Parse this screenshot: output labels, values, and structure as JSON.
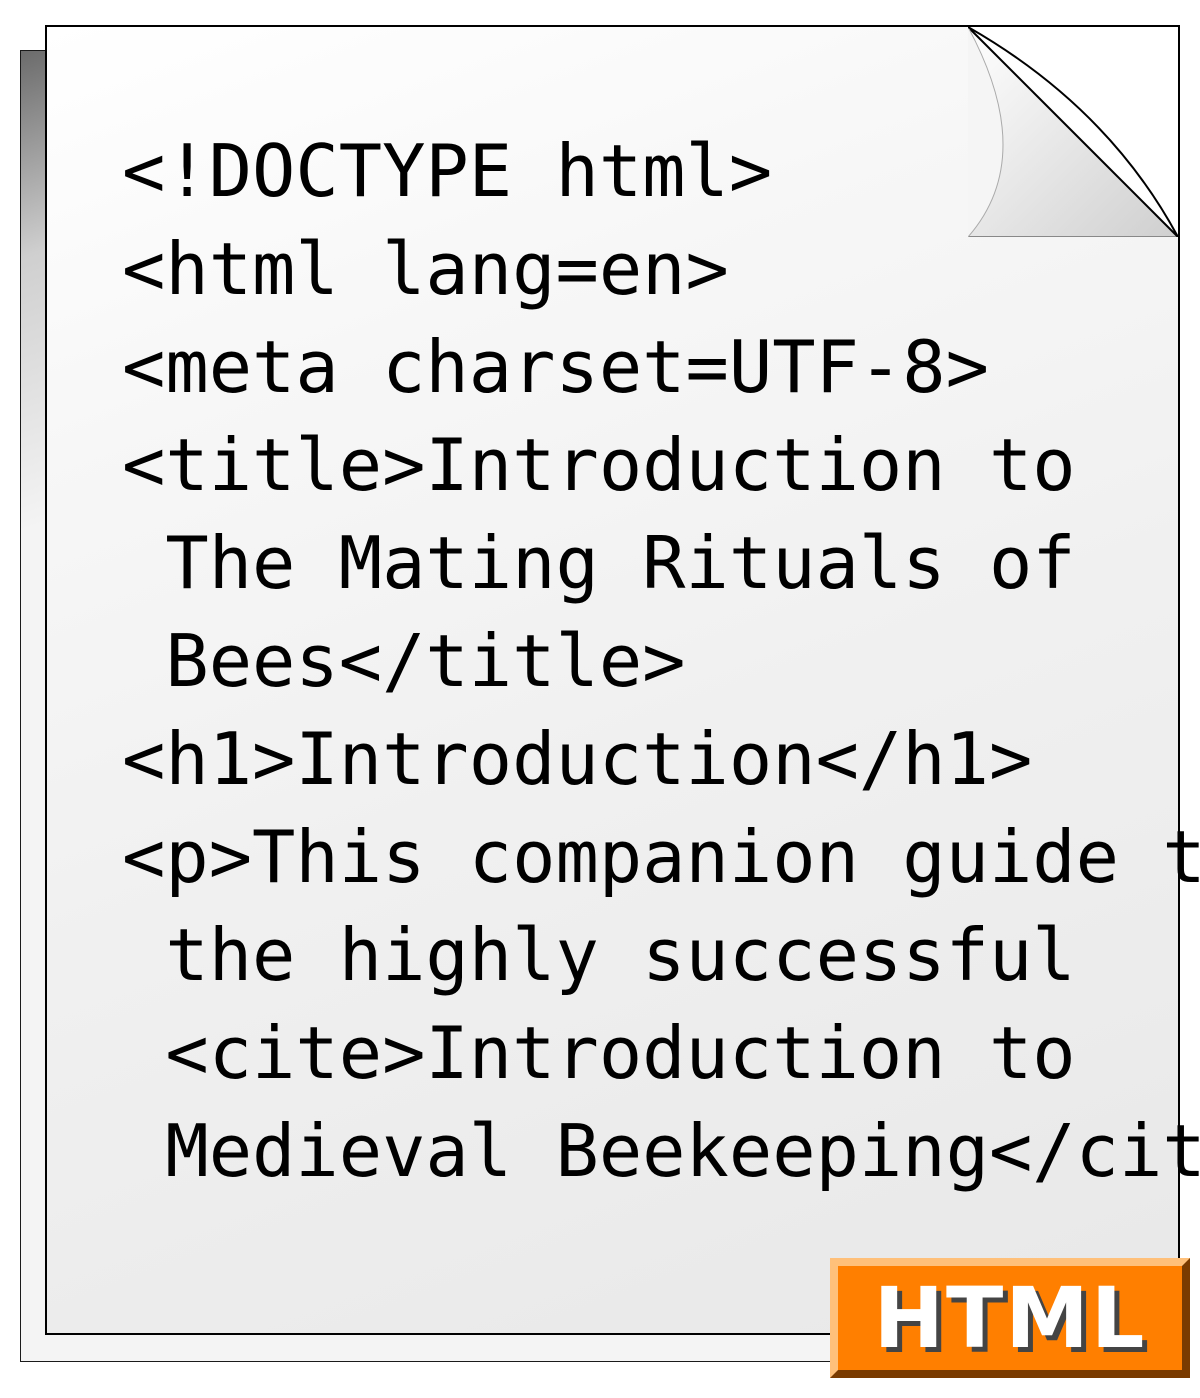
{
  "badge_label": "HTML",
  "code_lines": [
    "<!DOCTYPE html>",
    "<html lang=en>",
    "<meta charset=UTF-8>",
    "<title>Introduction to",
    " The Mating Rituals of",
    " Bees</title>",
    "<h1>Introduction</h1>",
    "<p>This companion guide to",
    " the highly successful",
    " <cite>Introduction to",
    " Medieval Beekeeping</cite>…"
  ]
}
